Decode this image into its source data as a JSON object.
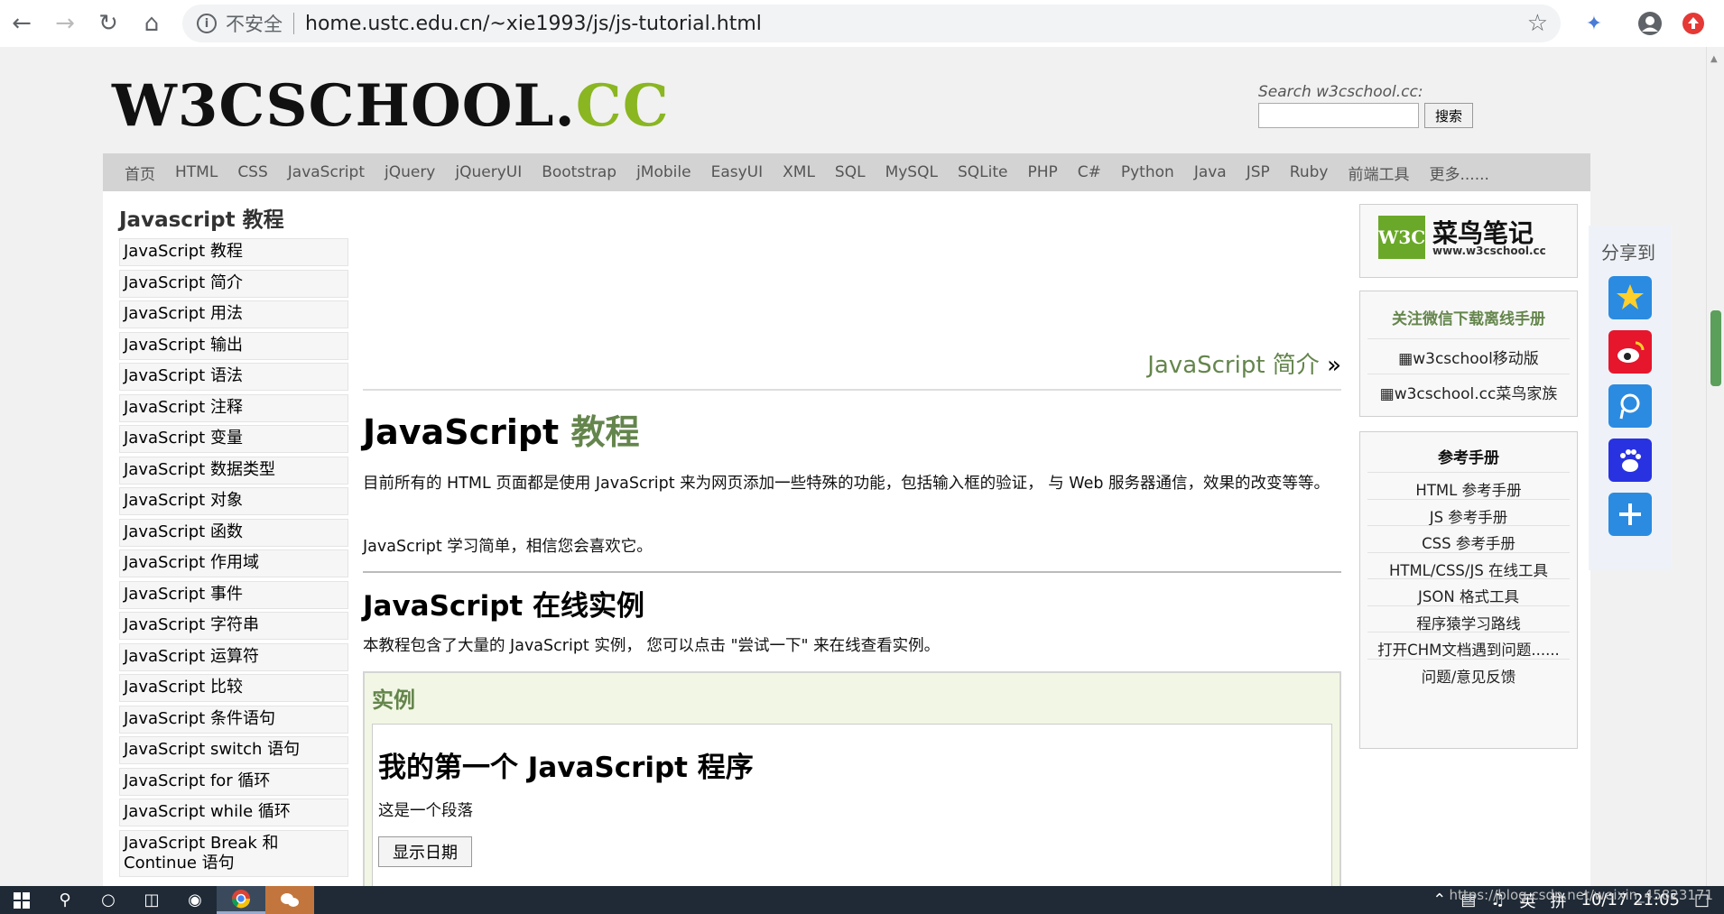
{
  "browser": {
    "insecure_label": "不安全",
    "url": "home.ustc.edu.cn/~xie1993/js/js-tutorial.html"
  },
  "header": {
    "logo_main": "W3CSCHOOL.",
    "logo_cc": "CC",
    "search_label": "Search w3cschool.cc:",
    "search_button": "搜索"
  },
  "topnav": [
    "首页",
    "HTML",
    "CSS",
    "JavaScript",
    "jQuery",
    "jQueryUI",
    "Bootstrap",
    "jMobile",
    "EasyUI",
    "XML",
    "SQL",
    "MySQL",
    "SQLite",
    "PHP",
    "C#",
    "Python",
    "Java",
    "JSP",
    "Ruby",
    "前端工具",
    "更多......"
  ],
  "sidebar": {
    "title": "Javascript 教程",
    "items": [
      "JavaScript 教程",
      "JavaScript 简介",
      "JavaScript 用法",
      "JavaScript 输出",
      "JavaScript 语法",
      "JavaScript 注释",
      "JavaScript 变量",
      "JavaScript 数据类型",
      "JavaScript 对象",
      "JavaScript 函数",
      "JavaScript 作用域",
      "JavaScript 事件",
      "JavaScript 字符串",
      "JavaScript 运算符",
      "JavaScript 比较",
      "JavaScript 条件语句",
      "JavaScript switch 语句",
      "JavaScript for 循环",
      "JavaScript while 循环",
      "JavaScript Break 和 Continue 语句"
    ]
  },
  "main": {
    "next_link": "JavaScript 简介",
    "next_arrow": "»",
    "h1_main": "JavaScript",
    "h1_green": "教程",
    "p1": "目前所有的 HTML 页面都是使用 JavaScript 来为网页添加一些特殊的功能，包括输入框的验证， 与 Web 服务器通信，效果的改变等等。",
    "p2": "JavaScript 学习简单，相信您会喜欢它。",
    "h2": "JavaScript 在线实例",
    "p3": "本教程包含了大量的 JavaScript 实例， 您可以点击 \"尝试一下\" 来在线查看实例。",
    "example_title": "实例",
    "example_heading": "我的第一个 JavaScript 程序",
    "example_paragraph": "这是一个段落",
    "example_button": "显示日期"
  },
  "right": {
    "cainiao_title": "菜鸟笔记",
    "cainiao_sub": "www.w3cschool.cc",
    "w3c_badge": "W3C",
    "wechat_title": "关注微信下载离线手册",
    "img_links": [
      "w3cschool移动版",
      "w3cschool.cc菜鸟家族"
    ],
    "ref_title": "参考手册",
    "ref_items": [
      "HTML 参考手册",
      "JS 参考手册",
      "CSS 参考手册",
      "HTML/CSS/JS 在线工具",
      "JSON 格式工具",
      "程序猿学习路线",
      "打开CHM文档遇到问题......",
      "问题/意见反馈"
    ]
  },
  "share": {
    "title": "分享到"
  },
  "taskbar": {
    "ime": "英",
    "ime2": "拼",
    "datetime": "10/17 21:05",
    "watermark": "https://blog.csdn.net/weixin_45823171"
  },
  "colors": {
    "accent_green": "#64854c",
    "logo_green": "#8ab621"
  }
}
